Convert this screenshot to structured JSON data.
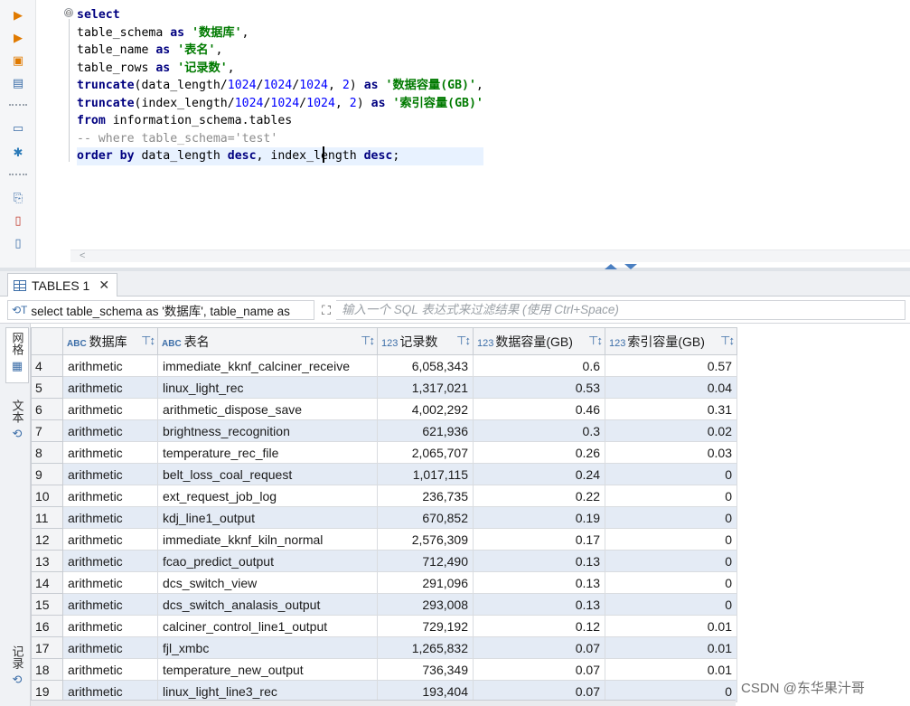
{
  "editor": {
    "code_lines": [
      [
        [
          "kw",
          "select"
        ]
      ],
      [
        [
          "id",
          "table_schema "
        ],
        [
          "kw",
          "as"
        ],
        [
          "id",
          " "
        ],
        [
          "str",
          "'数据库'"
        ],
        [
          "id",
          ","
        ]
      ],
      [
        [
          "id",
          "table_name "
        ],
        [
          "kw",
          "as"
        ],
        [
          "id",
          " "
        ],
        [
          "str",
          "'表名'"
        ],
        [
          "id",
          ","
        ]
      ],
      [
        [
          "id",
          "table_rows "
        ],
        [
          "kw",
          "as"
        ],
        [
          "id",
          " "
        ],
        [
          "str",
          "'记录数'"
        ],
        [
          "id",
          ","
        ]
      ],
      [
        [
          "fn",
          "truncate"
        ],
        [
          "id",
          "(data_length/"
        ],
        [
          "num",
          "1024"
        ],
        [
          "id",
          "/"
        ],
        [
          "num",
          "1024"
        ],
        [
          "id",
          "/"
        ],
        [
          "num",
          "1024"
        ],
        [
          "id",
          ", "
        ],
        [
          "num",
          "2"
        ],
        [
          "id",
          ") "
        ],
        [
          "kw",
          "as"
        ],
        [
          "id",
          " "
        ],
        [
          "str",
          "'数据容量(GB)'"
        ],
        [
          "id",
          ","
        ]
      ],
      [
        [
          "fn",
          "truncate"
        ],
        [
          "id",
          "(index_length/"
        ],
        [
          "num",
          "1024"
        ],
        [
          "id",
          "/"
        ],
        [
          "num",
          "1024"
        ],
        [
          "id",
          "/"
        ],
        [
          "num",
          "1024"
        ],
        [
          "id",
          ", "
        ],
        [
          "num",
          "2"
        ],
        [
          "id",
          ") "
        ],
        [
          "kw",
          "as"
        ],
        [
          "id",
          " "
        ],
        [
          "str",
          "'索引容量(GB)'"
        ]
      ],
      [
        [
          "kw",
          "from"
        ],
        [
          "id",
          " information_schema.tables"
        ]
      ],
      [
        [
          "cm",
          "-- where table_schema='test'"
        ]
      ],
      [
        [
          "kw",
          "order by"
        ],
        [
          "id",
          " data_length "
        ],
        [
          "kw",
          "desc"
        ],
        [
          "id",
          ", index_length "
        ],
        [
          "kw",
          "desc"
        ],
        [
          "id",
          ";"
        ]
      ]
    ],
    "fold_symbol": "⊖",
    "scroll_left_arrow": "<"
  },
  "results": {
    "tab_label": "TABLES 1",
    "tab_close": "✕",
    "filter_sql": "select table_schema as '数据库', table_name as",
    "filter_placeholder": "输入一个 SQL 表达式来过滤结果 (使用 Ctrl+Space)",
    "side_tabs": {
      "grid": "网格",
      "text": "文本",
      "record": "记录"
    },
    "columns": [
      {
        "type": "ABC",
        "label": "数据库"
      },
      {
        "type": "ABC",
        "label": "表名"
      },
      {
        "type": "123",
        "label": "记录数"
      },
      {
        "type": "123",
        "label": "数据容量(GB)"
      },
      {
        "type": "123",
        "label": "索引容量(GB)"
      }
    ],
    "rows": [
      [
        "4",
        "arithmetic",
        "immediate_kknf_calciner_receive",
        "6,058,343",
        "0.6",
        "0.57"
      ],
      [
        "5",
        "arithmetic",
        "linux_light_rec",
        "1,317,021",
        "0.53",
        "0.04"
      ],
      [
        "6",
        "arithmetic",
        "arithmetic_dispose_save",
        "4,002,292",
        "0.46",
        "0.31"
      ],
      [
        "7",
        "arithmetic",
        "brightness_recognition",
        "621,936",
        "0.3",
        "0.02"
      ],
      [
        "8",
        "arithmetic",
        "temperature_rec_file",
        "2,065,707",
        "0.26",
        "0.03"
      ],
      [
        "9",
        "arithmetic",
        "belt_loss_coal_request",
        "1,017,115",
        "0.24",
        "0"
      ],
      [
        "10",
        "arithmetic",
        "ext_request_job_log",
        "236,735",
        "0.22",
        "0"
      ],
      [
        "11",
        "arithmetic",
        "kdj_line1_output",
        "670,852",
        "0.19",
        "0"
      ],
      [
        "12",
        "arithmetic",
        "immediate_kknf_kiln_normal",
        "2,576,309",
        "0.17",
        "0"
      ],
      [
        "13",
        "arithmetic",
        "fcao_predict_output",
        "712,490",
        "0.13",
        "0"
      ],
      [
        "14",
        "arithmetic",
        "dcs_switch_view",
        "291,096",
        "0.13",
        "0"
      ],
      [
        "15",
        "arithmetic",
        "dcs_switch_analasis_output",
        "293,008",
        "0.13",
        "0"
      ],
      [
        "16",
        "arithmetic",
        "calciner_control_line1_output",
        "729,192",
        "0.12",
        "0.01"
      ],
      [
        "17",
        "arithmetic",
        "fjl_xmbc",
        "1,265,832",
        "0.07",
        "0.01"
      ],
      [
        "18",
        "arithmetic",
        "temperature_new_output",
        "736,349",
        "0.07",
        "0.01"
      ],
      [
        "19",
        "arithmetic",
        "linux_light_line3_rec",
        "193,404",
        "0.07",
        "0"
      ]
    ]
  },
  "watermark": "CSDN @东华果汁哥"
}
